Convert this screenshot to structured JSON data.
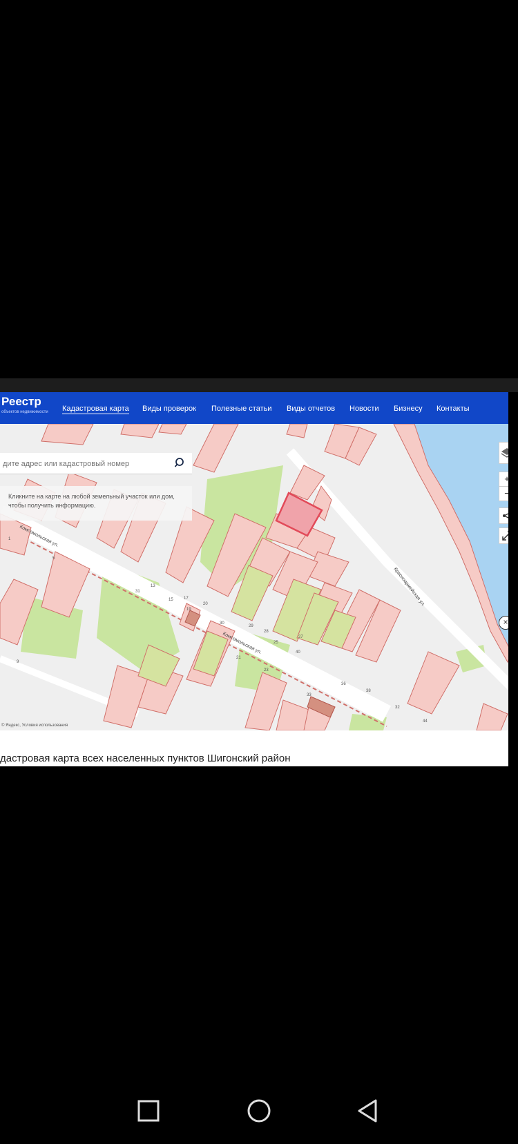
{
  "header": {
    "logo": "Реестр",
    "logo_sub": "объектов недвижимости",
    "nav": [
      {
        "label": "Кадастровая карта",
        "active": true
      },
      {
        "label": "Виды проверок"
      },
      {
        "label": "Полезные статьи"
      },
      {
        "label": "Виды отчетов"
      },
      {
        "label": "Новости"
      },
      {
        "label": "Бизнесу"
      },
      {
        "label": "Контакты"
      }
    ]
  },
  "search": {
    "placeholder": "дите адрес или кадастровый номер",
    "icon": "search-icon"
  },
  "hint": "Кликните на карте на любой земельный участок или дом, чтобы получить информацию.",
  "map": {
    "streets": [
      "Комсомольская ул.",
      "Комсомольская ул.",
      "Красноармейская ул."
    ],
    "house_numbers": [
      "13",
      "17",
      "19",
      "20",
      "21",
      "23",
      "25",
      "27",
      "28",
      "29",
      "30",
      "31",
      "32",
      "33",
      "40",
      "15",
      "1",
      "5",
      "9",
      "36",
      "38",
      "44"
    ],
    "selected_parcel_color": "#e24a59",
    "parcel_color": "#f6cbc6",
    "greenery_color": "#c9e5a0",
    "water_color": "#a9d3f2",
    "attribution": "© Яндекс, Условия использования"
  },
  "controls": {
    "zoom_in": "+",
    "zoom_out": "−",
    "close": "×"
  },
  "caption": "дастровая карта всех населенных пунктов Шигонский район"
}
